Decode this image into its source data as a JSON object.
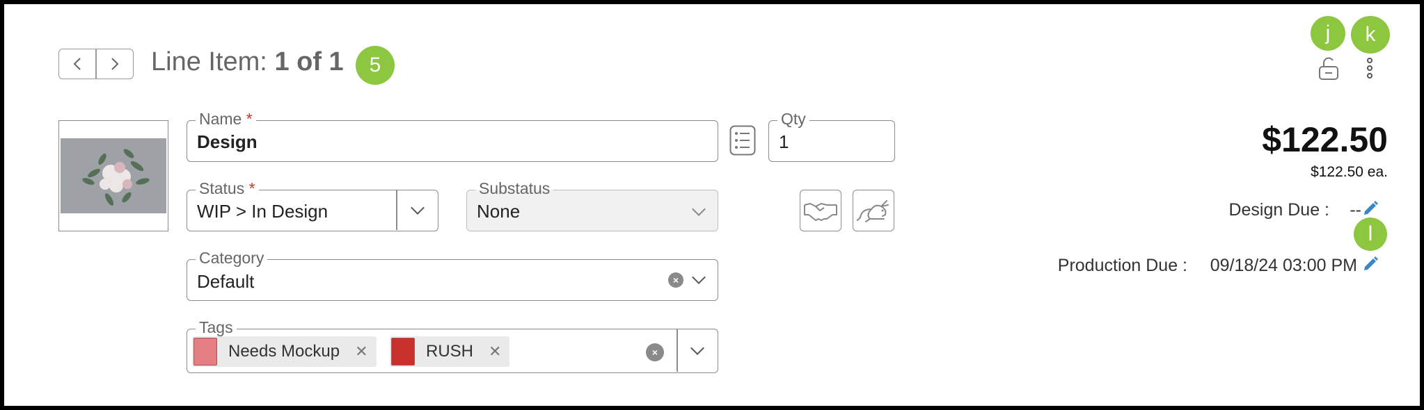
{
  "header": {
    "title_prefix": "Line Item:",
    "title_count": "1 of 1",
    "prev_icon": "chevron-left-icon",
    "next_icon": "chevron-right-icon"
  },
  "badges": {
    "b5": "5",
    "bj": "j",
    "bk": "k",
    "bl": "l"
  },
  "colors": {
    "badge": "#8dc63f",
    "required": "#c0392b",
    "edit": "#3a87c8"
  },
  "form": {
    "name": {
      "label": "Name",
      "required": "*",
      "value": "Design"
    },
    "qty": {
      "label": "Qty",
      "value": "1"
    },
    "status": {
      "label": "Status",
      "required": "*",
      "value": "WIP > In Design"
    },
    "substatus": {
      "label": "Substatus",
      "value": "None"
    },
    "category": {
      "label": "Category",
      "value": "Default"
    },
    "tags": {
      "label": "Tags",
      "items": [
        {
          "label": "Needs Mockup",
          "color": "#e57f84"
        },
        {
          "label": "RUSH",
          "color": "#c9302c"
        }
      ]
    }
  },
  "pricing": {
    "total": "$122.50",
    "each": "$122.50 ea.",
    "design_due_label": "Design Due :",
    "design_due_value": "--",
    "production_due_label": "Production Due :",
    "production_due_value": "09/18/24 03:00 PM"
  },
  "icons": [
    "lock-open-icon",
    "more-vertical-icon",
    "list-icon",
    "handshake-icon",
    "rabbit-icon",
    "pencil-icon",
    "clear-icon"
  ]
}
